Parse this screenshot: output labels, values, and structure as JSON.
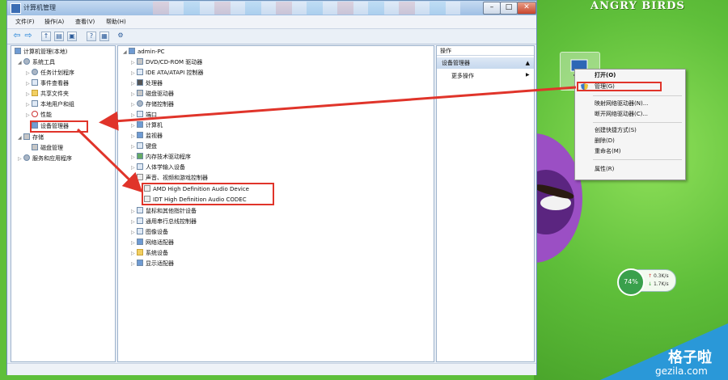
{
  "window": {
    "title": "计算机管理",
    "menus": [
      "文件(F)",
      "操作(A)",
      "查看(V)",
      "帮助(H)"
    ]
  },
  "left_tree": [
    {
      "label": "计算机管理(本地)",
      "indent": 0,
      "arrow": ""
    },
    {
      "label": "系统工具",
      "indent": 1,
      "arrow": "◢"
    },
    {
      "label": "任务计划程序",
      "indent": 2,
      "arrow": "▷"
    },
    {
      "label": "事件查看器",
      "indent": 2,
      "arrow": "▷"
    },
    {
      "label": "共享文件夹",
      "indent": 2,
      "arrow": "▷"
    },
    {
      "label": "本地用户和组",
      "indent": 2,
      "arrow": "▷"
    },
    {
      "label": "性能",
      "indent": 2,
      "arrow": "▷"
    },
    {
      "label": "设备管理器",
      "indent": 2,
      "arrow": ""
    },
    {
      "label": "存储",
      "indent": 1,
      "arrow": "◢"
    },
    {
      "label": "磁盘管理",
      "indent": 2,
      "arrow": ""
    },
    {
      "label": "服务和应用程序",
      "indent": 1,
      "arrow": "▷"
    }
  ],
  "device_tree": {
    "root": "admin-PC",
    "items": [
      "DVD/CD-ROM 驱动器",
      "IDE ATA/ATAPI 控制器",
      "处理器",
      "磁盘驱动器",
      "存储控制器",
      "端口",
      "计算机",
      "监视器",
      "键盘",
      "内存技术驱动程序",
      "人体学输入设备",
      "声音、视频和游戏控制器"
    ],
    "audio_devices": [
      "AMD High Definition Audio Device",
      "IDT High Definition Audio CODEC"
    ],
    "items_after": [
      "鼠标和其他指针设备",
      "通用串行总线控制器",
      "图像设备",
      "网络适配器",
      "系统设备",
      "显示适配器"
    ]
  },
  "actions": {
    "header": "操作",
    "section": "设备管理器",
    "more": "更多操作"
  },
  "context_menu": [
    {
      "label": "打开(O)",
      "bold": true
    },
    {
      "label": "管理(G)"
    },
    {
      "sep": true
    },
    {
      "label": "映射网络驱动器(N)..."
    },
    {
      "label": "断开网络驱动器(C)..."
    },
    {
      "sep": true
    },
    {
      "label": "创建快捷方式(S)"
    },
    {
      "label": "删除(D)"
    },
    {
      "label": "重命名(M)"
    },
    {
      "sep": true
    },
    {
      "label": "属性(R)"
    }
  ],
  "desktop": {
    "logo": "ANGRY BIRDS"
  },
  "net_widget": {
    "percent": "74%",
    "up": "0.3K/s",
    "down": "1.7K/s"
  },
  "watermark": {
    "text": "格子啦",
    "url": "gezila.com"
  },
  "colors": {
    "annotation_red": "#e0342a",
    "desktop_green": "#5fbf3a",
    "watermark_blue": "#2a98d8"
  }
}
